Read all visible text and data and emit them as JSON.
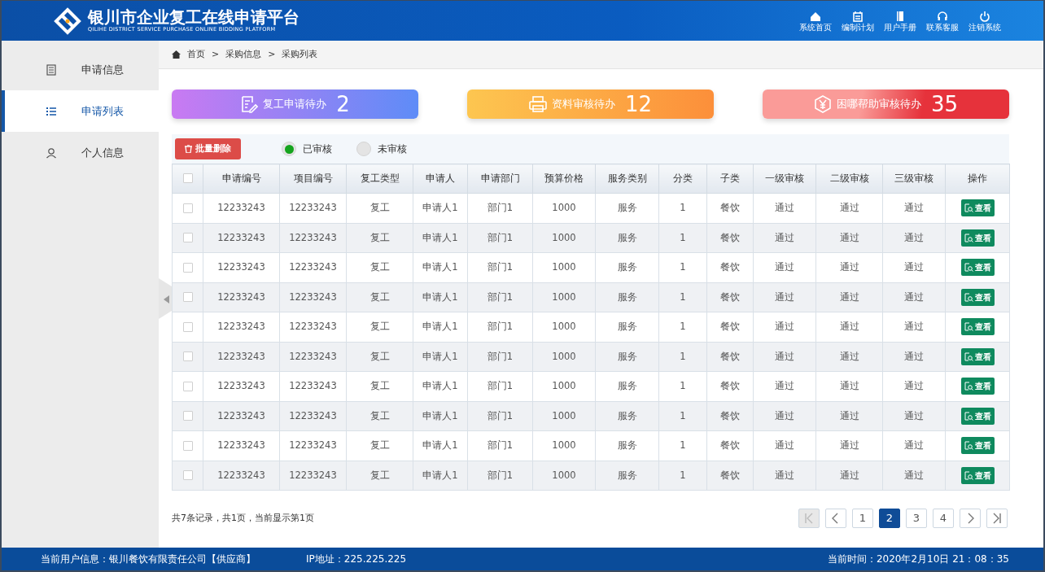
{
  "header": {
    "title": "银川市企业复工在线申请平台",
    "subtitle": "QILIHE DISTRICT SERVICE PURCHASE ONLINE BIDDING PLATFORM",
    "nav": [
      {
        "kind": "home",
        "label": "系统首页"
      },
      {
        "kind": "plan",
        "label": "编制计划"
      },
      {
        "kind": "manual",
        "label": "用户手册"
      },
      {
        "kind": "service",
        "label": "联系客服"
      },
      {
        "kind": "logout",
        "label": "注销系统"
      }
    ]
  },
  "sidebar": {
    "items": [
      {
        "kind": "info",
        "label": "申请信息",
        "selected": false
      },
      {
        "kind": "list",
        "label": "申请列表",
        "selected": true
      },
      {
        "kind": "person",
        "label": "个人信息",
        "selected": false
      }
    ]
  },
  "breadcrumb": [
    "首页",
    "采购信息",
    "采购列表"
  ],
  "breadcrumb_separator": ">",
  "cards": [
    {
      "kind": "apply",
      "label": "复工申请待办",
      "count": "2"
    },
    {
      "kind": "review",
      "label": "资料审核待办",
      "count": "12"
    },
    {
      "kind": "aid",
      "label": "困哪帮助审核待办",
      "count": "35"
    }
  ],
  "toolbar": {
    "delete_button": "批量删除",
    "filters": [
      {
        "label": "已审核",
        "selected": true
      },
      {
        "label": "未审核",
        "selected": false
      }
    ]
  },
  "table": {
    "all_checked": false,
    "columns": [
      "申请编号",
      "项目编号",
      "复工类型",
      "申请人",
      "申请部门",
      "预算价格",
      "服务类别",
      "分类",
      "子类",
      "一级审核",
      "二级审核",
      "三级审核",
      "操作"
    ],
    "rows": [
      {
        "checked": false,
        "cells": [
          "12233243",
          "12233243",
          "复工",
          "申请人1",
          "部门1",
          "1000",
          "服务",
          "1",
          "餐饮",
          "通过",
          "通过",
          "通过"
        ],
        "action": "查看"
      },
      {
        "checked": false,
        "cells": [
          "12233243",
          "12233243",
          "复工",
          "申请人1",
          "部门1",
          "1000",
          "服务",
          "1",
          "餐饮",
          "通过",
          "通过",
          "通过"
        ],
        "action": "查看"
      },
      {
        "checked": false,
        "cells": [
          "12233243",
          "12233243",
          "复工",
          "申请人1",
          "部门1",
          "1000",
          "服务",
          "1",
          "餐饮",
          "通过",
          "通过",
          "通过"
        ],
        "action": "查看"
      },
      {
        "checked": false,
        "cells": [
          "12233243",
          "12233243",
          "复工",
          "申请人1",
          "部门1",
          "1000",
          "服务",
          "1",
          "餐饮",
          "通过",
          "通过",
          "通过"
        ],
        "action": "查看"
      },
      {
        "checked": false,
        "cells": [
          "12233243",
          "12233243",
          "复工",
          "申请人1",
          "部门1",
          "1000",
          "服务",
          "1",
          "餐饮",
          "通过",
          "通过",
          "通过"
        ],
        "action": "查看"
      },
      {
        "checked": false,
        "cells": [
          "12233243",
          "12233243",
          "复工",
          "申请人1",
          "部门1",
          "1000",
          "服务",
          "1",
          "餐饮",
          "通过",
          "通过",
          "通过"
        ],
        "action": "查看"
      },
      {
        "checked": false,
        "cells": [
          "12233243",
          "12233243",
          "复工",
          "申请人1",
          "部门1",
          "1000",
          "服务",
          "1",
          "餐饮",
          "通过",
          "通过",
          "通过"
        ],
        "action": "查看"
      },
      {
        "checked": false,
        "cells": [
          "12233243",
          "12233243",
          "复工",
          "申请人1",
          "部门1",
          "1000",
          "服务",
          "1",
          "餐饮",
          "通过",
          "通过",
          "通过"
        ],
        "action": "查看"
      },
      {
        "checked": false,
        "cells": [
          "12233243",
          "12233243",
          "复工",
          "申请人1",
          "部门1",
          "1000",
          "服务",
          "1",
          "餐饮",
          "通过",
          "通过",
          "通过"
        ],
        "action": "查看"
      },
      {
        "checked": false,
        "cells": [
          "12233243",
          "12233243",
          "复工",
          "申请人1",
          "部门1",
          "1000",
          "服务",
          "1",
          "餐饮",
          "通过",
          "通过",
          "通过"
        ],
        "action": "查看"
      }
    ]
  },
  "summary": "共7条记录，共1页，当前显示第1页",
  "pagination": {
    "first_disabled": true,
    "pages": [
      {
        "label": "1",
        "selected": false
      },
      {
        "label": "2",
        "selected": true
      },
      {
        "label": "3",
        "selected": false
      },
      {
        "label": "4",
        "selected": false
      }
    ]
  },
  "status_bar": {
    "user": "当前用户信息：银川餐饮有限责任公司【供应商】",
    "ip": "IP地址：225.225.225",
    "time": "当前时间：2020年2月10日 21：08：35"
  }
}
